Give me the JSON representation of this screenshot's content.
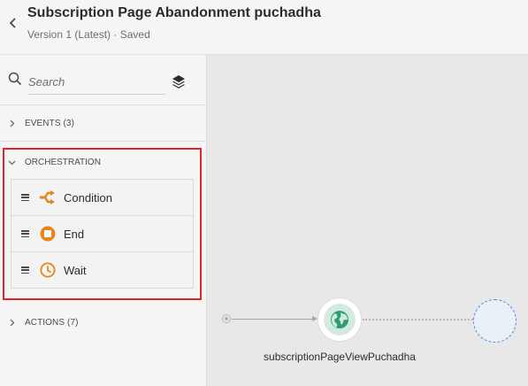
{
  "header": {
    "title": "Subscription Page Abandonment puchadha",
    "subtitle": "Version 1 (Latest) · Saved"
  },
  "palette": {
    "search": {
      "placeholder": "Search"
    },
    "sections": {
      "events": {
        "label": "EVENTS (3)"
      },
      "orchestration": {
        "label": "ORCHESTRATION",
        "items": [
          {
            "label": "Condition",
            "icon": "condition-icon",
            "color": "#e68619"
          },
          {
            "label": "End",
            "icon": "end-icon",
            "color": "#e68619"
          },
          {
            "label": "Wait",
            "icon": "wait-icon",
            "color": "#e68619"
          }
        ]
      },
      "actions": {
        "label": "ACTIONS (7)"
      }
    },
    "highlight_color": "#e3232a"
  },
  "canvas": {
    "event_node": {
      "label": "subscriptionPageViewPuchadha",
      "icon": "globe-icon",
      "color": "#2d9d78"
    }
  }
}
